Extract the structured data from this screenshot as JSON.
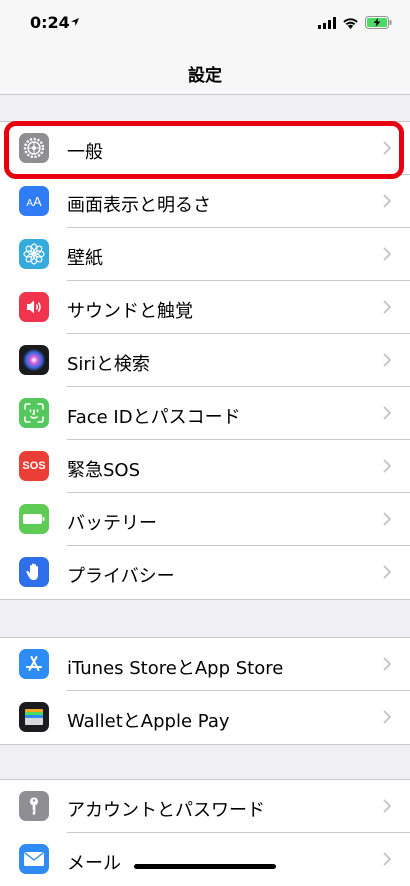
{
  "status_bar": {
    "time": "0:24"
  },
  "nav": {
    "title": "設定"
  },
  "groups": [
    {
      "items": [
        {
          "label": "一般",
          "icon": "gear-icon",
          "color": "#8e8e93",
          "selected": true
        },
        {
          "label": "画面表示と明るさ",
          "icon": "display-aa-icon",
          "color": "#2f7cf6"
        },
        {
          "label": "壁紙",
          "icon": "wallpaper-flower-icon",
          "color": "#35aadc"
        },
        {
          "label": "サウンドと触覚",
          "icon": "speaker-icon",
          "color": "#f0344d"
        },
        {
          "label": "Siriと検索",
          "icon": "siri-icon",
          "color": "#1b1b1f"
        },
        {
          "label": "Face IDとパスコード",
          "icon": "face-id-icon",
          "color": "#54c75d"
        },
        {
          "label": "緊急SOS",
          "icon": "sos-icon",
          "color": "#ea3e36",
          "icon_text": "SOS"
        },
        {
          "label": "バッテリー",
          "icon": "battery-icon",
          "color": "#5ecb54"
        },
        {
          "label": "プライバシー",
          "icon": "hand-icon",
          "color": "#2f6fea"
        }
      ]
    },
    {
      "items": [
        {
          "label": "iTunes StoreとApp Store",
          "icon": "app-store-icon",
          "color": "#2d8cf6"
        },
        {
          "label": "WalletとApple Pay",
          "icon": "wallet-icon",
          "color": "#1c1c1e"
        }
      ]
    },
    {
      "items": [
        {
          "label": "アカウントとパスワード",
          "icon": "key-icon",
          "color": "#8e8e93"
        },
        {
          "label": "メール",
          "icon": "mail-icon",
          "color": "#2f8cf6"
        }
      ]
    }
  ]
}
